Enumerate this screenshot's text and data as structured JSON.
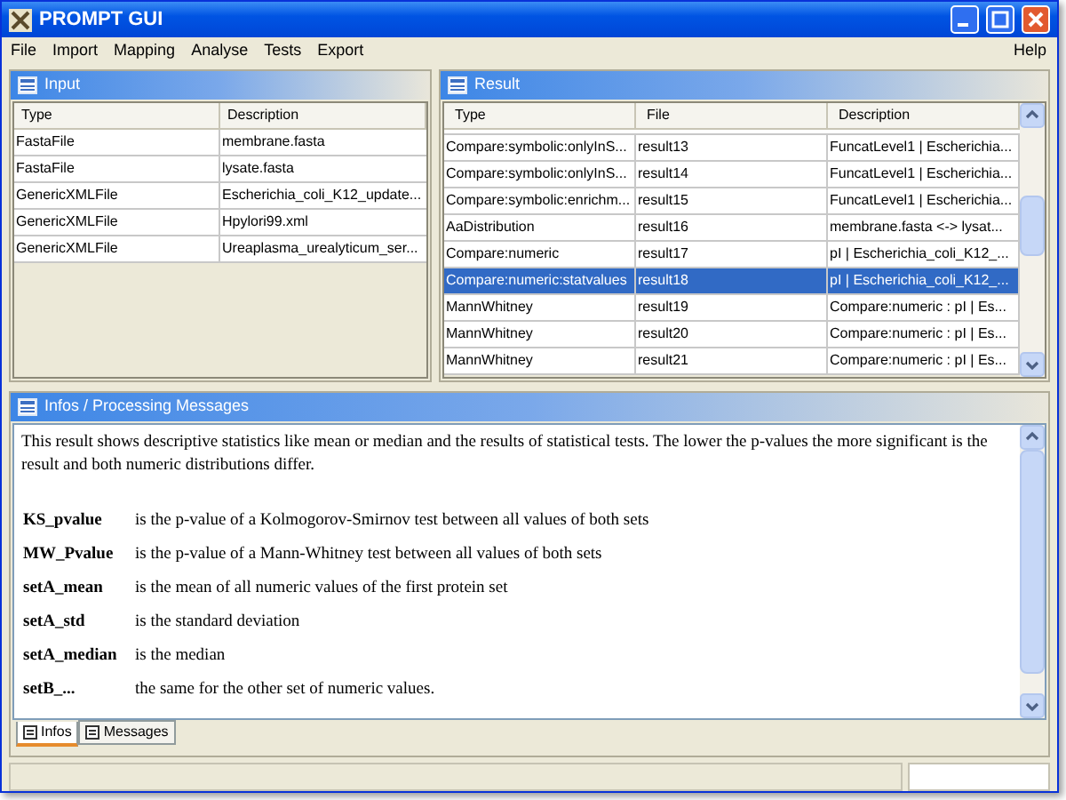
{
  "window": {
    "title": "PROMPT GUI"
  },
  "menu": [
    "File",
    "Import",
    "Mapping",
    "Analyse",
    "Tests",
    "Export"
  ],
  "menu_right": "Help",
  "input_panel": {
    "title": "Input",
    "columns": [
      "Type",
      "Description"
    ],
    "rows": [
      [
        "FastaFile",
        "membrane.fasta"
      ],
      [
        "FastaFile",
        "lysate.fasta"
      ],
      [
        "GenericXMLFile",
        "Escherichia_coli_K12_update..."
      ],
      [
        "GenericXMLFile",
        "Hpylori99.xml"
      ],
      [
        "GenericXMLFile",
        "Ureaplasma_urealyticum_ser..."
      ]
    ]
  },
  "result_panel": {
    "title": "Result",
    "columns": [
      "Type",
      "File",
      "Description"
    ],
    "rows": [
      {
        "cells": [
          "Compare:symbolic:onlyInS...",
          "result13",
          "FuncatLevel1 | Escherichia..."
        ],
        "selected": false
      },
      {
        "cells": [
          "Compare:symbolic:onlyInS...",
          "result14",
          "FuncatLevel1 | Escherichia..."
        ],
        "selected": false
      },
      {
        "cells": [
          "Compare:symbolic:enrichm...",
          "result15",
          "FuncatLevel1 | Escherichia..."
        ],
        "selected": false
      },
      {
        "cells": [
          "AaDistribution",
          "result16",
          "membrane.fasta <-> lysat..."
        ],
        "selected": false
      },
      {
        "cells": [
          "Compare:numeric",
          "result17",
          "pI | Escherichia_coli_K12_..."
        ],
        "selected": false
      },
      {
        "cells": [
          "Compare:numeric:statvalues",
          "result18",
          "pI | Escherichia_coli_K12_..."
        ],
        "selected": true
      },
      {
        "cells": [
          "MannWhitney",
          "result19",
          "Compare:numeric : pI | Es..."
        ],
        "selected": false
      },
      {
        "cells": [
          "MannWhitney",
          "result20",
          "Compare:numeric : pI | Es..."
        ],
        "selected": false
      },
      {
        "cells": [
          "MannWhitney",
          "result21",
          "Compare:numeric : pI | Es..."
        ],
        "selected": false
      }
    ]
  },
  "info_panel": {
    "title": "Infos / Processing Messages",
    "paragraph": "This result shows descriptive statistics like mean or median and the results of statistical tests.  The lower the p-values the more significant is the result and both numeric distributions differ.",
    "definitions": [
      {
        "term": "KS_pvalue",
        "text": "is the p-value of a Kolmogorov-Smirnov test between all values of both sets"
      },
      {
        "term": "MW_Pvalue",
        "text": "is the p-value of a Mann-Whitney test between all values of both sets"
      },
      {
        "term": "setA_mean",
        "text": "is the mean of all numeric values of the first protein set"
      },
      {
        "term": "setA_std",
        "text": "is the standard deviation"
      },
      {
        "term": "setA_median",
        "text": "is the median"
      },
      {
        "term": "setB_...",
        "text": "the same for the other set of numeric values."
      }
    ],
    "tabs": [
      {
        "label": "Infos",
        "selected": true
      },
      {
        "label": "Messages",
        "selected": false
      }
    ]
  }
}
